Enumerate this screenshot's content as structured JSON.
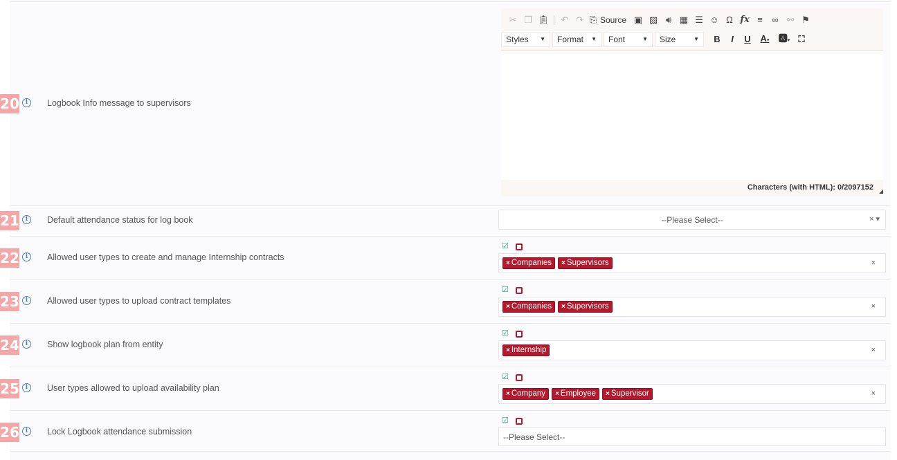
{
  "rows": [
    {
      "number": "20",
      "label": "Logbook Info message to supervisors"
    },
    {
      "number": "21",
      "label": "Default attendance status for log book"
    },
    {
      "number": "22",
      "label": "Allowed user types to create and manage Internship contracts"
    },
    {
      "number": "23",
      "label": "Allowed user types to upload contract templates"
    },
    {
      "number": "24",
      "label": "Show logbook plan from entity"
    },
    {
      "number": "25",
      "label": "User types allowed to upload availability plan"
    },
    {
      "number": "26",
      "label": "Lock Logbook attendance submission"
    }
  ],
  "editor": {
    "source_label": "Source",
    "styles_label": "Styles",
    "format_label": "Format",
    "font_label": "Font",
    "size_label": "Size",
    "character_count": "Characters (with HTML): 0/2097152"
  },
  "attendance_select": {
    "placeholder": "--Please Select--",
    "controls": "× ▾"
  },
  "contracts_tags": [
    {
      "text": "Companies"
    },
    {
      "text": "Supervisors"
    }
  ],
  "templates_tags": [
    {
      "text": "Companies"
    },
    {
      "text": "Supervisors"
    }
  ],
  "logbook_plan_tags": [
    {
      "text": "Internship"
    }
  ],
  "availability_tags": [
    {
      "text": "Company"
    },
    {
      "text": "Employee"
    },
    {
      "text": "Supervisor"
    }
  ],
  "lock_select": {
    "placeholder": "--Please Select--"
  },
  "clear_glyph": "×",
  "tag_remove_glyph": "×",
  "colors": {
    "number_badge": "#f5a6a6",
    "tag": "#b3192c",
    "check": "#2ba88a",
    "info_icon": "#4a7fc1"
  }
}
